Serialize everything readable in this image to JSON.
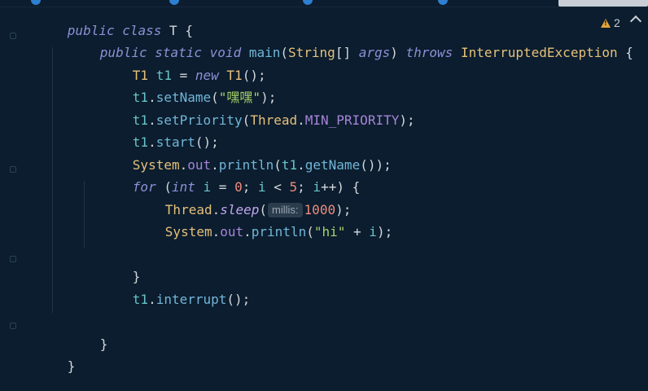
{
  "editor": {
    "warning_count": "2",
    "lines": {
      "l1": [
        "public",
        "class",
        "T",
        "{"
      ],
      "l2": [
        "public",
        "static",
        "void",
        "main",
        "(",
        "String",
        "[] ",
        "args",
        ") ",
        "throws",
        "InterruptedException",
        " {"
      ],
      "l3": [
        "T1",
        "t1",
        " = ",
        "new",
        "T1",
        "();"
      ],
      "l4": [
        "t1",
        ".",
        "setName",
        "(",
        "\"嘿嘿\"",
        ");"
      ],
      "l5": [
        "t1",
        ".",
        "setPriority",
        "(",
        "Thread",
        ".",
        "MIN_PRIORITY",
        ");"
      ],
      "l6": [
        "t1",
        ".",
        "start",
        "();"
      ],
      "l7": [
        "System",
        ".",
        "out",
        ".",
        "println",
        "(",
        "t1",
        ".",
        "getName",
        "());"
      ],
      "l8": [
        "for",
        " (",
        "int",
        "i",
        " = ",
        "0",
        "; ",
        "i",
        " < ",
        "5",
        "; ",
        "i",
        "++",
        ") {"
      ],
      "l9": [
        "Thread",
        ".",
        "sleep",
        "(",
        "millis:",
        "1000",
        ");"
      ],
      "l10": [
        "System",
        ".",
        "out",
        ".",
        "println",
        "(",
        "\"hi\"",
        " + ",
        "i",
        ");"
      ],
      "l11": [
        "}"
      ],
      "l12": [
        "t1",
        ".",
        "interrupt",
        "();"
      ],
      "l13": [
        "}"
      ],
      "l14": [
        "}"
      ]
    }
  }
}
